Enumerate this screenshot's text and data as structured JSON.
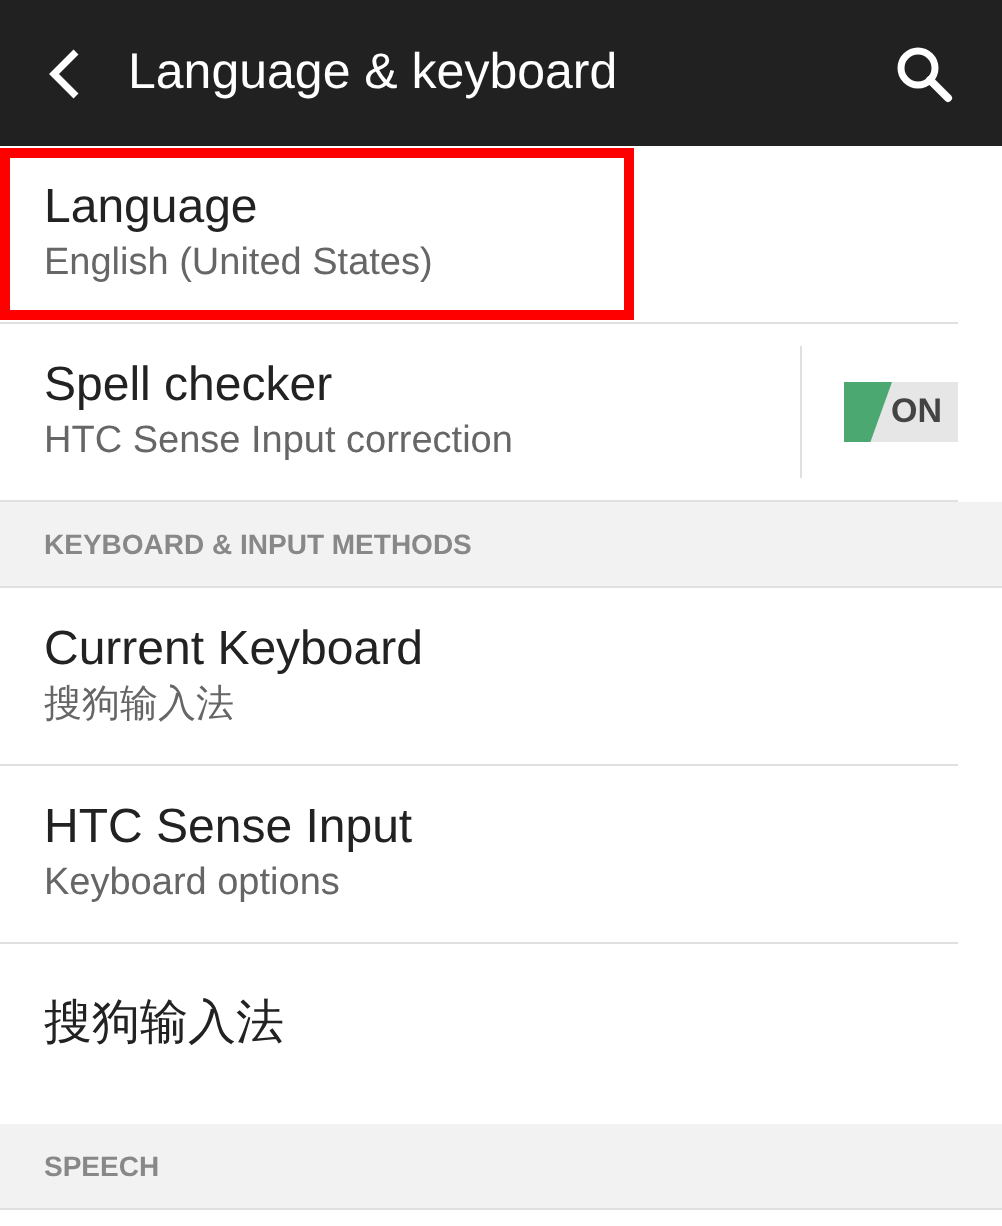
{
  "app_bar": {
    "title": "Language & keyboard"
  },
  "rows": [
    {
      "kind": "item",
      "title": "Language",
      "subtitle": "English (United States)",
      "highlighted": true
    },
    {
      "kind": "switch",
      "title": "Spell checker",
      "subtitle": "HTC Sense Input correction",
      "on": true,
      "switch_label": "ON"
    },
    {
      "kind": "header",
      "title": "KEYBOARD & INPUT METHODS"
    },
    {
      "kind": "item",
      "title": "Current Keyboard",
      "subtitle": "搜狗输入法",
      "highlighted": false
    },
    {
      "kind": "item",
      "title": "HTC Sense Input",
      "subtitle": "Keyboard options",
      "highlighted": false
    },
    {
      "kind": "item",
      "title": "搜狗输入法",
      "highlighted": false
    },
    {
      "kind": "header",
      "title": "SPEECH"
    }
  ]
}
